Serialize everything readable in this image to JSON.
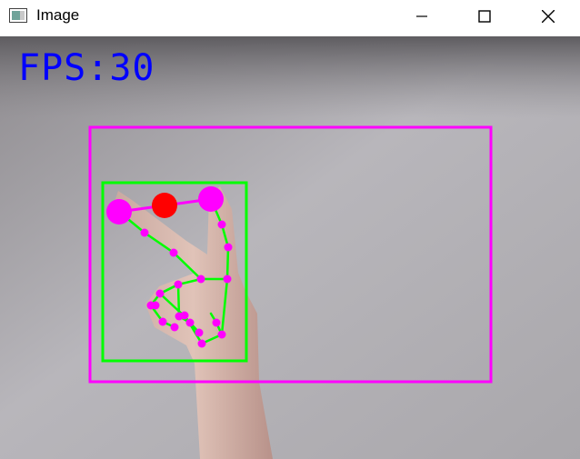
{
  "window": {
    "title": "Image",
    "app_icon": "image-window-icon",
    "controls": {
      "minimize": "minimize-icon",
      "maximize": "maximize-icon",
      "close": "close-icon"
    }
  },
  "overlay": {
    "fps_text": "FPS:30",
    "fps_color": "#0000ff",
    "hand_box_color": "#ff00ff",
    "inner_box_color": "#00ff00",
    "landmark_color": "#ff00ff",
    "connection_color": "#00ff00",
    "midpoint_color": "#ff0000"
  }
}
